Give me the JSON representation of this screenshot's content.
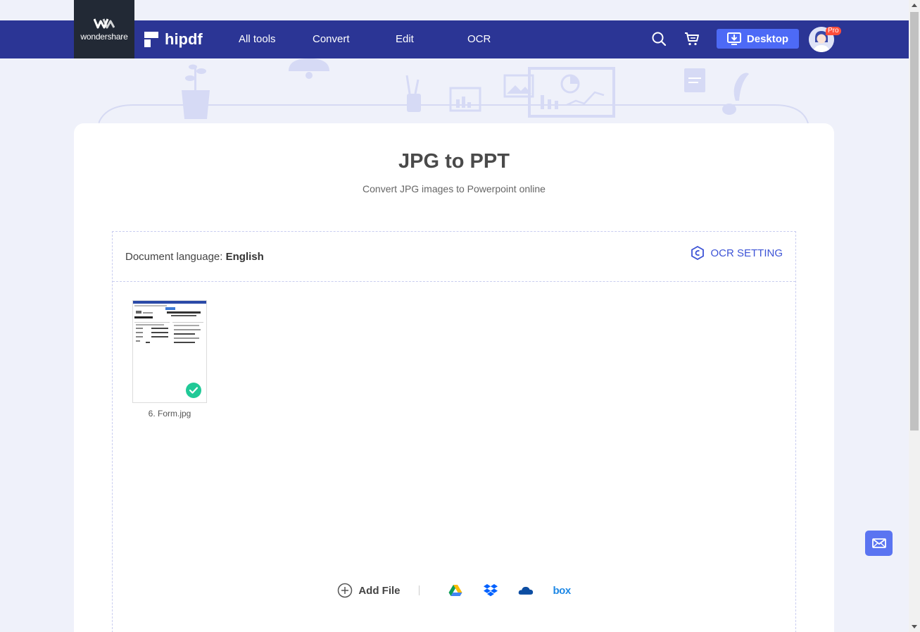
{
  "brand": {
    "wondershare_label": "wondershare",
    "hipdf_label": "hipdf"
  },
  "nav": {
    "items": [
      {
        "label": "All tools"
      },
      {
        "label": "Convert"
      },
      {
        "label": "Edit"
      },
      {
        "label": "OCR"
      }
    ],
    "desktop_label": "Desktop",
    "pro_badge": "Pro"
  },
  "page": {
    "title": "JPG to PPT",
    "subtitle": "Convert JPG images to Powerpoint online"
  },
  "ocr": {
    "language_label": "Document language:",
    "language_value": "English",
    "setting_label": "OCR SETTING"
  },
  "files": [
    {
      "name": "6. Form.jpg",
      "status": "uploaded"
    }
  ],
  "actions": {
    "add_file_label": "Add File",
    "cloud_sources": [
      "google-drive",
      "dropbox",
      "onedrive",
      "box"
    ],
    "box_label": "box"
  },
  "colors": {
    "nav_bg": "#2b3595",
    "accent": "#4d6af6",
    "success": "#20c997",
    "page_bg": "#eff1fa"
  }
}
